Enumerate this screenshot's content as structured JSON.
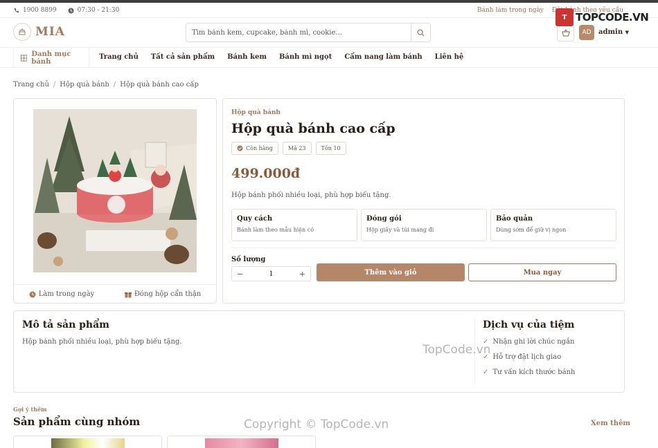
{
  "topbar": {
    "phone": "1900 8899",
    "hours": "07:30 - 21:30",
    "link_custom": "Bánh làm trong ngày",
    "link_order": "Đặt bánh theo yêu cầu"
  },
  "brand": {
    "logo_text": "MIA",
    "accent": "#a5795a"
  },
  "search": {
    "placeholder": "Tìm bánh kem, cupcake, bánh mì, cookie..."
  },
  "user": {
    "initials": "AD",
    "name": "admin"
  },
  "watermark": {
    "logo": "TOPCODE.VN",
    "center": "TopCode.vn",
    "copyright": "Copyright © TopCode.vn"
  },
  "nav": {
    "category": "Danh mục bánh",
    "links": [
      "Trang chủ",
      "Tất cả sản phẩm",
      "Bánh kem",
      "Bánh mì ngọt",
      "Cẩm nang làm bánh",
      "Liên hệ"
    ]
  },
  "breadcrumb": [
    "Trang chủ",
    "Hộp quà bánh",
    "Hộp quà bánh cao cấp"
  ],
  "gallery": {
    "features": [
      "Làm trong ngày",
      "Đóng hộp cẩn thận"
    ]
  },
  "product": {
    "category": "Hộp quà bánh",
    "title": "Hộp quà bánh cao cấp",
    "badges": [
      "Còn hàng",
      "Mã 23",
      "Tồn 10"
    ],
    "price": "499.000đ",
    "description": "Hộp bánh phối nhiều loại, phù hợp biếu tặng.",
    "specs": [
      {
        "title": "Quy cách",
        "text": "Bánh làm theo mẫu hiện có"
      },
      {
        "title": "Đóng gói",
        "text": "Hộp giấy và túi mang đi"
      },
      {
        "title": "Bảo quản",
        "text": "Dùng sớm để giữ vị ngon"
      }
    ],
    "quantity_label": "Số lượng",
    "quantity": "1",
    "add_to_cart": "Thêm vào giỏ",
    "buy_now": "Mua ngay"
  },
  "details": {
    "title": "Mô tả sản phẩm",
    "text": "Hộp bánh phối nhiều loại, phù hợp biếu tặng.",
    "services_title": "Dịch vụ của tiệm",
    "services": [
      "Nhận ghi lời chúc ngắn",
      "Hỗ trợ đặt lịch giao",
      "Tư vấn kích thước bánh"
    ]
  },
  "related": {
    "label": "Gợi ý thêm",
    "title": "Sản phẩm cùng nhóm",
    "see_more": "Xem thêm"
  }
}
